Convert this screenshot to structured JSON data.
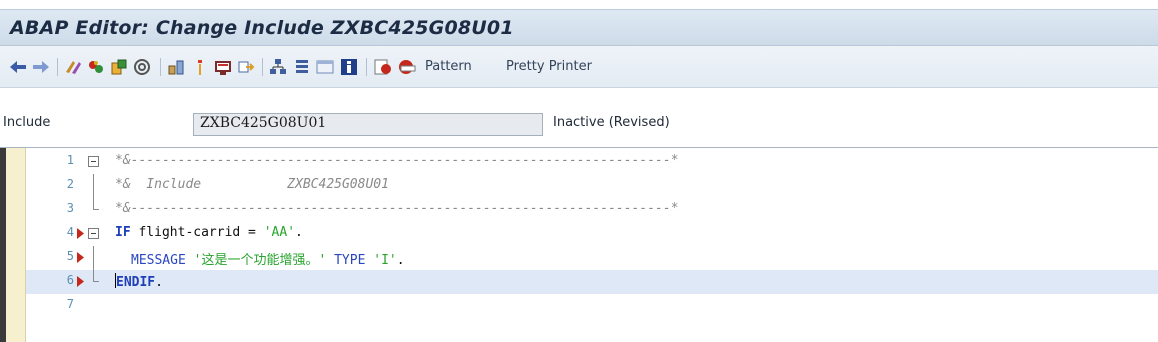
{
  "window": {
    "title": "ABAP Editor: Change Include ZXBC425G08U01"
  },
  "toolbar": {
    "icons": [
      "back-arrow-icon",
      "forward-arrow-icon",
      "toggle-display-change-icon",
      "activate-icon",
      "check-icon",
      "where-used-icon",
      "object-list-icon",
      "info-icon",
      "display-object-list-icon",
      "navigate-icon",
      "hierarchy-icon",
      "layout-icon",
      "fullscreen-icon",
      "help-icon",
      "set-breakpoint-icon",
      "delete-breakpoint-icon"
    ],
    "pattern_label": "Pattern",
    "pretty_printer_label": "Pretty Printer"
  },
  "include_field": {
    "label": "Include",
    "value": "ZXBC425G08U01",
    "status": "Inactive (Revised)"
  },
  "editor": {
    "lines": [
      {
        "number": "1",
        "text": "*&---------------------------------------------------------------------*"
      },
      {
        "number": "2",
        "text": "*&  Include           ZXBC425G08U01"
      },
      {
        "number": "3",
        "text": "*&---------------------------------------------------------------------*"
      },
      {
        "number": "4",
        "kw": "IF",
        "rest1": " flight-carrid = ",
        "str": "'AA'",
        "rest2": "."
      },
      {
        "number": "5",
        "kw": "MESSAGE",
        "str": "'这是一个功能增强。'",
        "kw2": "TYPE",
        "str2": "'I'",
        "rest2": "."
      },
      {
        "number": "6",
        "kw": "NDIF",
        "first": "E",
        "rest2": "."
      },
      {
        "number": "7"
      }
    ]
  },
  "colors": {
    "keyword": "#1f3fb8",
    "string": "#27a42c",
    "comment": "#8a8a8a",
    "line_number": "#5b8fb3",
    "active_line": "#dfe8f6",
    "breakpoint_marker": "#c4281c"
  }
}
